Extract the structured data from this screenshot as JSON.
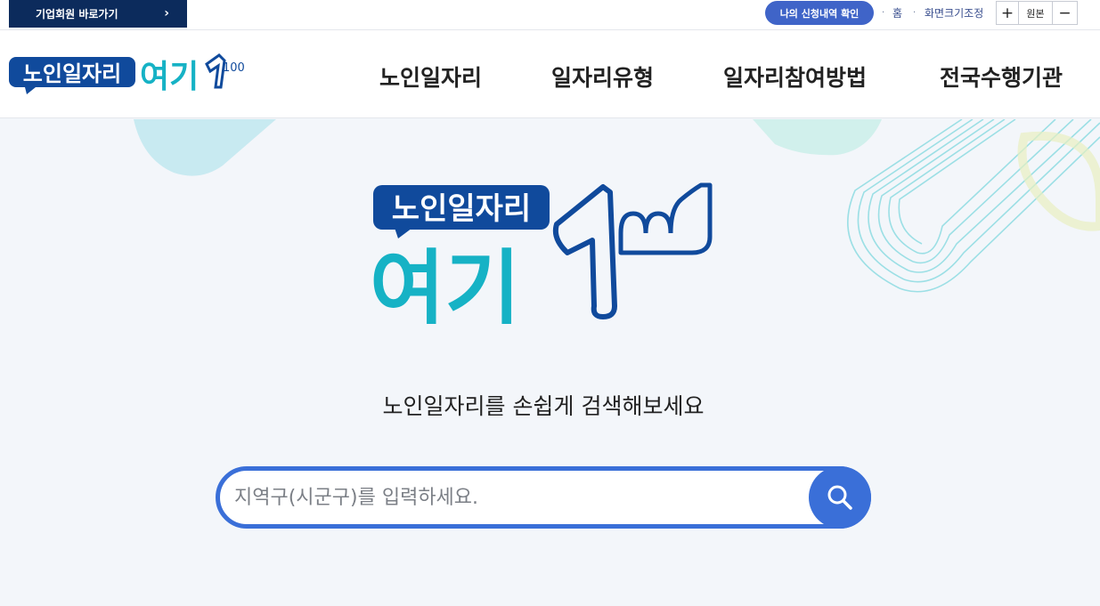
{
  "topbar": {
    "corporate_link": "기업회원 바로가기",
    "corporate_chevron": "›",
    "apply_history": "나의 신청내역 확인",
    "home": "홈",
    "font_size_label": "화면크기조정",
    "zoom_in": "+",
    "zoom_reset": "원본",
    "zoom_out": "−"
  },
  "logo": {
    "line1": "노인일자리",
    "line2": "여기",
    "mark": "100"
  },
  "nav": {
    "items": [
      "노인일자리",
      "일자리유형",
      "일자리참여방법",
      "전국수행기관"
    ]
  },
  "hero": {
    "tagline": "노인일자리를 손쉽게 검색해보세요"
  },
  "search": {
    "placeholder": "지역구(시군구)를 입력하세요.",
    "value": "",
    "button_icon": "search-icon"
  },
  "colors": {
    "navy": "#0c2b5c",
    "brand_blue": "#104a9c",
    "brand_teal": "#16b2c5",
    "search_blue": "#3a6fd8",
    "apply_blue": "#3f64c8"
  }
}
